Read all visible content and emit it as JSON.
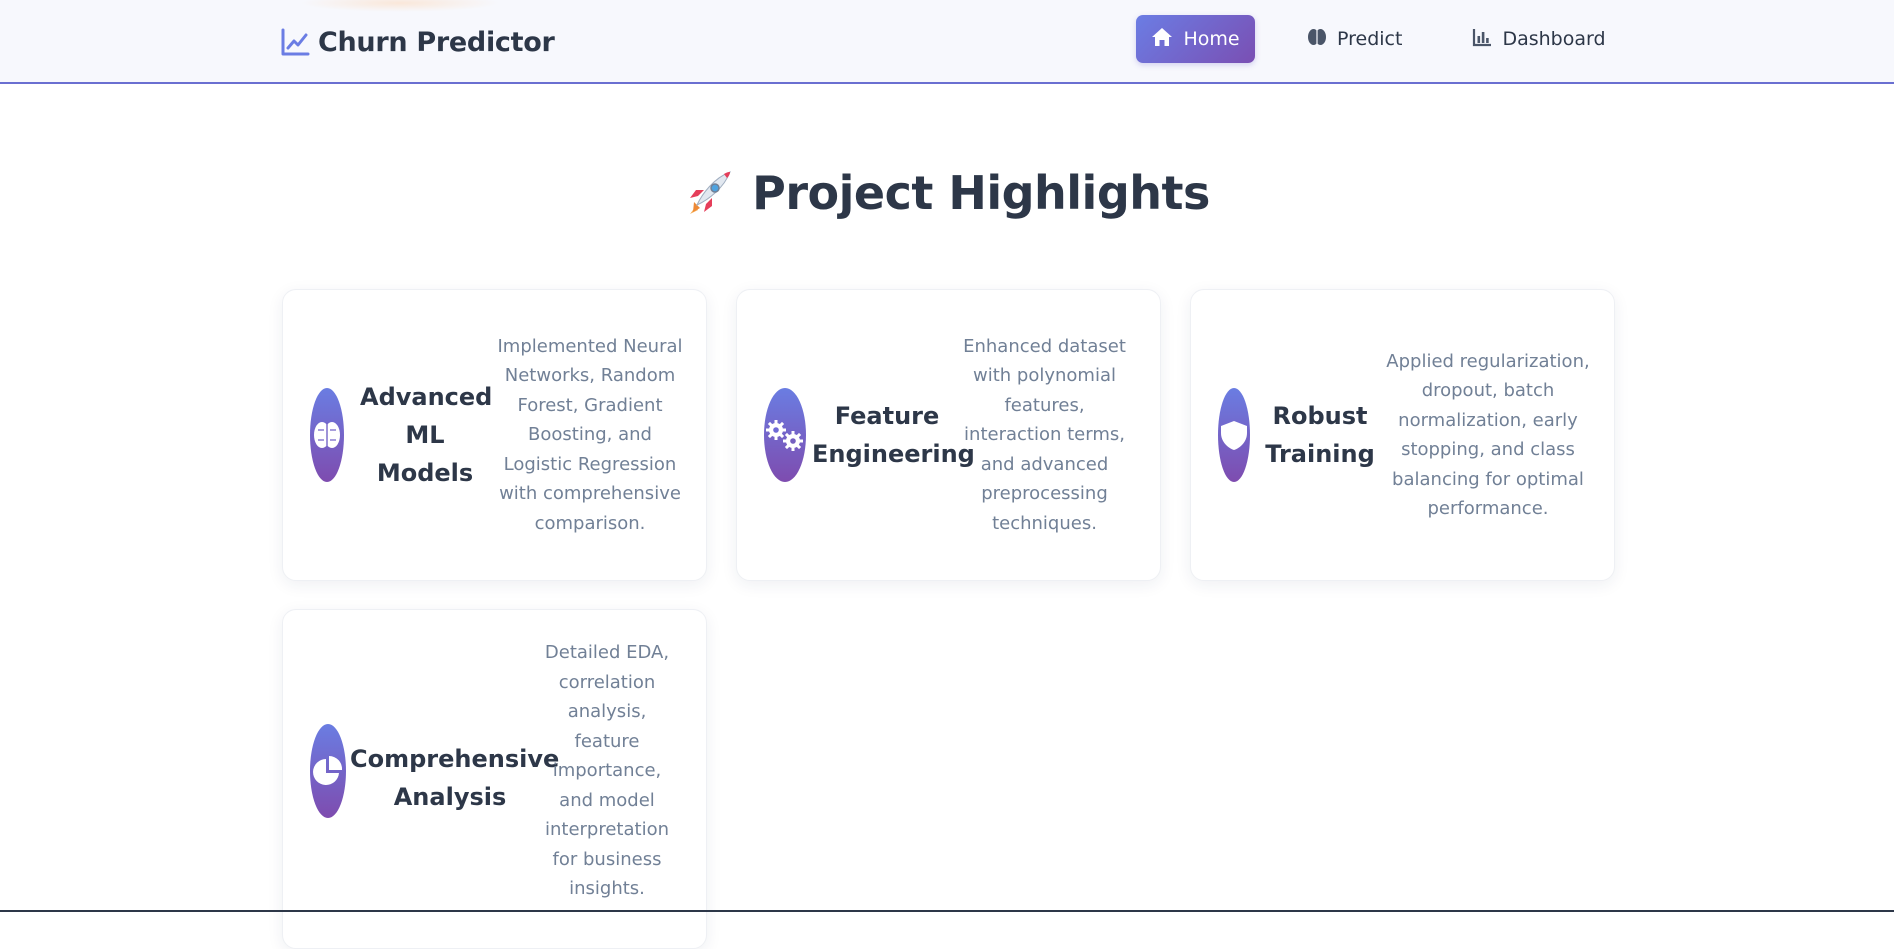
{
  "header": {
    "brand_title": "Churn Predictor",
    "brand_icon": "chart-line-icon",
    "nav": [
      {
        "label": "Home",
        "icon": "home-icon",
        "active": true
      },
      {
        "label": "Predict",
        "icon": "brain-icon",
        "active": false
      },
      {
        "label": "Dashboard",
        "icon": "bar-chart-icon",
        "active": false
      }
    ]
  },
  "main": {
    "section_title": "Project Highlights",
    "section_icon": "rocket-icon",
    "cards": [
      {
        "title": "Advanced ML Models",
        "icon": "brain-icon",
        "description": "Implemented Neural Networks, Random Forest, Gradient Boosting, and Logistic Regression with comprehensive comparison."
      },
      {
        "title": "Feature Engineering",
        "icon": "cogs-icon",
        "description": "Enhanced dataset with polynomial features, interaction terms, and advanced preprocessing techniques."
      },
      {
        "title": "Robust Training",
        "icon": "shield-icon",
        "description": "Applied regularization, dropout, batch normalization, early stopping, and class balancing for optimal performance."
      },
      {
        "title": "Comprehensive Analysis",
        "icon": "pie-chart-icon",
        "description": "Detailed EDA, correlation analysis, feature importance, and model interpretation for business insights."
      }
    ]
  },
  "colors": {
    "accent_start": "#6b7de4",
    "accent_end": "#7a4fb3",
    "text_dark": "#2d3748",
    "text_muted": "#718096",
    "nav_border": "#6a6fd1"
  }
}
